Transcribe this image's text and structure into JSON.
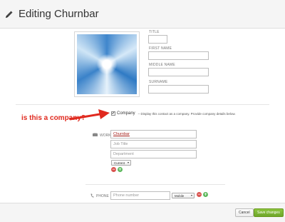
{
  "header": {
    "title": "Editing Churnbar",
    "icon": "pencil-icon"
  },
  "name_fields": {
    "title_label": "TITLE",
    "first_name_label": "FIRST NAME",
    "middle_name_label": "MIDDLE NAME",
    "surname_label": "SURNAME"
  },
  "company": {
    "checked": true,
    "label": "Company",
    "description": "– Display this contact as a company. Provide company details below."
  },
  "annotation": {
    "text": "is this a company?",
    "color": "#e0291e"
  },
  "work": {
    "label": "WORK",
    "company_value": "Churnbar",
    "job_title_placeholder": "Job Title",
    "department_placeholder": "Department",
    "status_value": "Current"
  },
  "phone": {
    "label": "PHONE",
    "placeholder": "Phone number",
    "type_value": "Mobile"
  },
  "footer": {
    "cancel_label": "Cancel",
    "save_label": "Save changes",
    "save_color": "#7cb833"
  }
}
